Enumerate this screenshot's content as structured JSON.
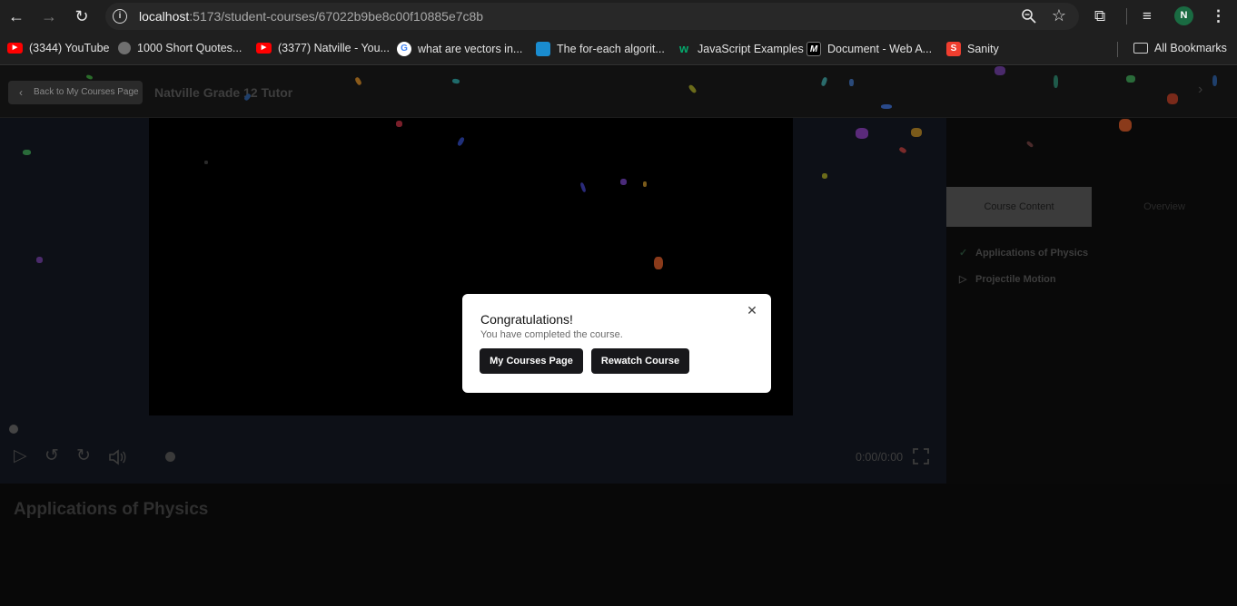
{
  "browser": {
    "url_host": "localhost",
    "url_path": ":5173/student-courses/67022b9be8c00f10885e7c8b",
    "profile_initial": "N",
    "bookmarks": [
      {
        "label": "(3344) YouTube",
        "icon": "youtube-icon",
        "color": "#ff0000"
      },
      {
        "label": "1000 Short Quotes...",
        "icon": "globe-icon",
        "color": "#9a9a9a"
      },
      {
        "label": "(3377) Natville - You...",
        "icon": "youtube-icon",
        "color": "#ff0000"
      },
      {
        "label": "what are vectors in...",
        "icon": "google-icon",
        "color": "#ffffff"
      },
      {
        "label": "The for-each algorit...",
        "icon": "site-icon",
        "color": "#1a8ccf"
      },
      {
        "label": "JavaScript Examples",
        "icon": "w3schools-icon",
        "color": "#04aa6d"
      },
      {
        "label": "Document - Web A...",
        "icon": "mdn-icon",
        "color": "#000000"
      },
      {
        "label": "Sanity",
        "icon": "sanity-icon",
        "color": "#f03e2f"
      }
    ],
    "all_bookmarks_label": "All Bookmarks"
  },
  "header": {
    "back_label": "Back to My Courses Page",
    "course_title": "Natville Grade 12 Tutor"
  },
  "player": {
    "time": "0:00/0:00"
  },
  "lesson": {
    "title": "Applications of Physics"
  },
  "sidebar": {
    "tabs": [
      {
        "label": "Course Content"
      },
      {
        "label": "Overview"
      }
    ],
    "lessons": [
      {
        "label": "Applications of Physics",
        "status": "completed"
      },
      {
        "label": "Projectile Motion",
        "status": "play"
      }
    ]
  },
  "modal": {
    "title": "Congratulations!",
    "description": "You have completed the course.",
    "primary_label": "My Courses Page",
    "secondary_label": "Rewatch Course"
  },
  "colors": {
    "modal_button": "#18181b",
    "avatar": "#1a6b42"
  }
}
